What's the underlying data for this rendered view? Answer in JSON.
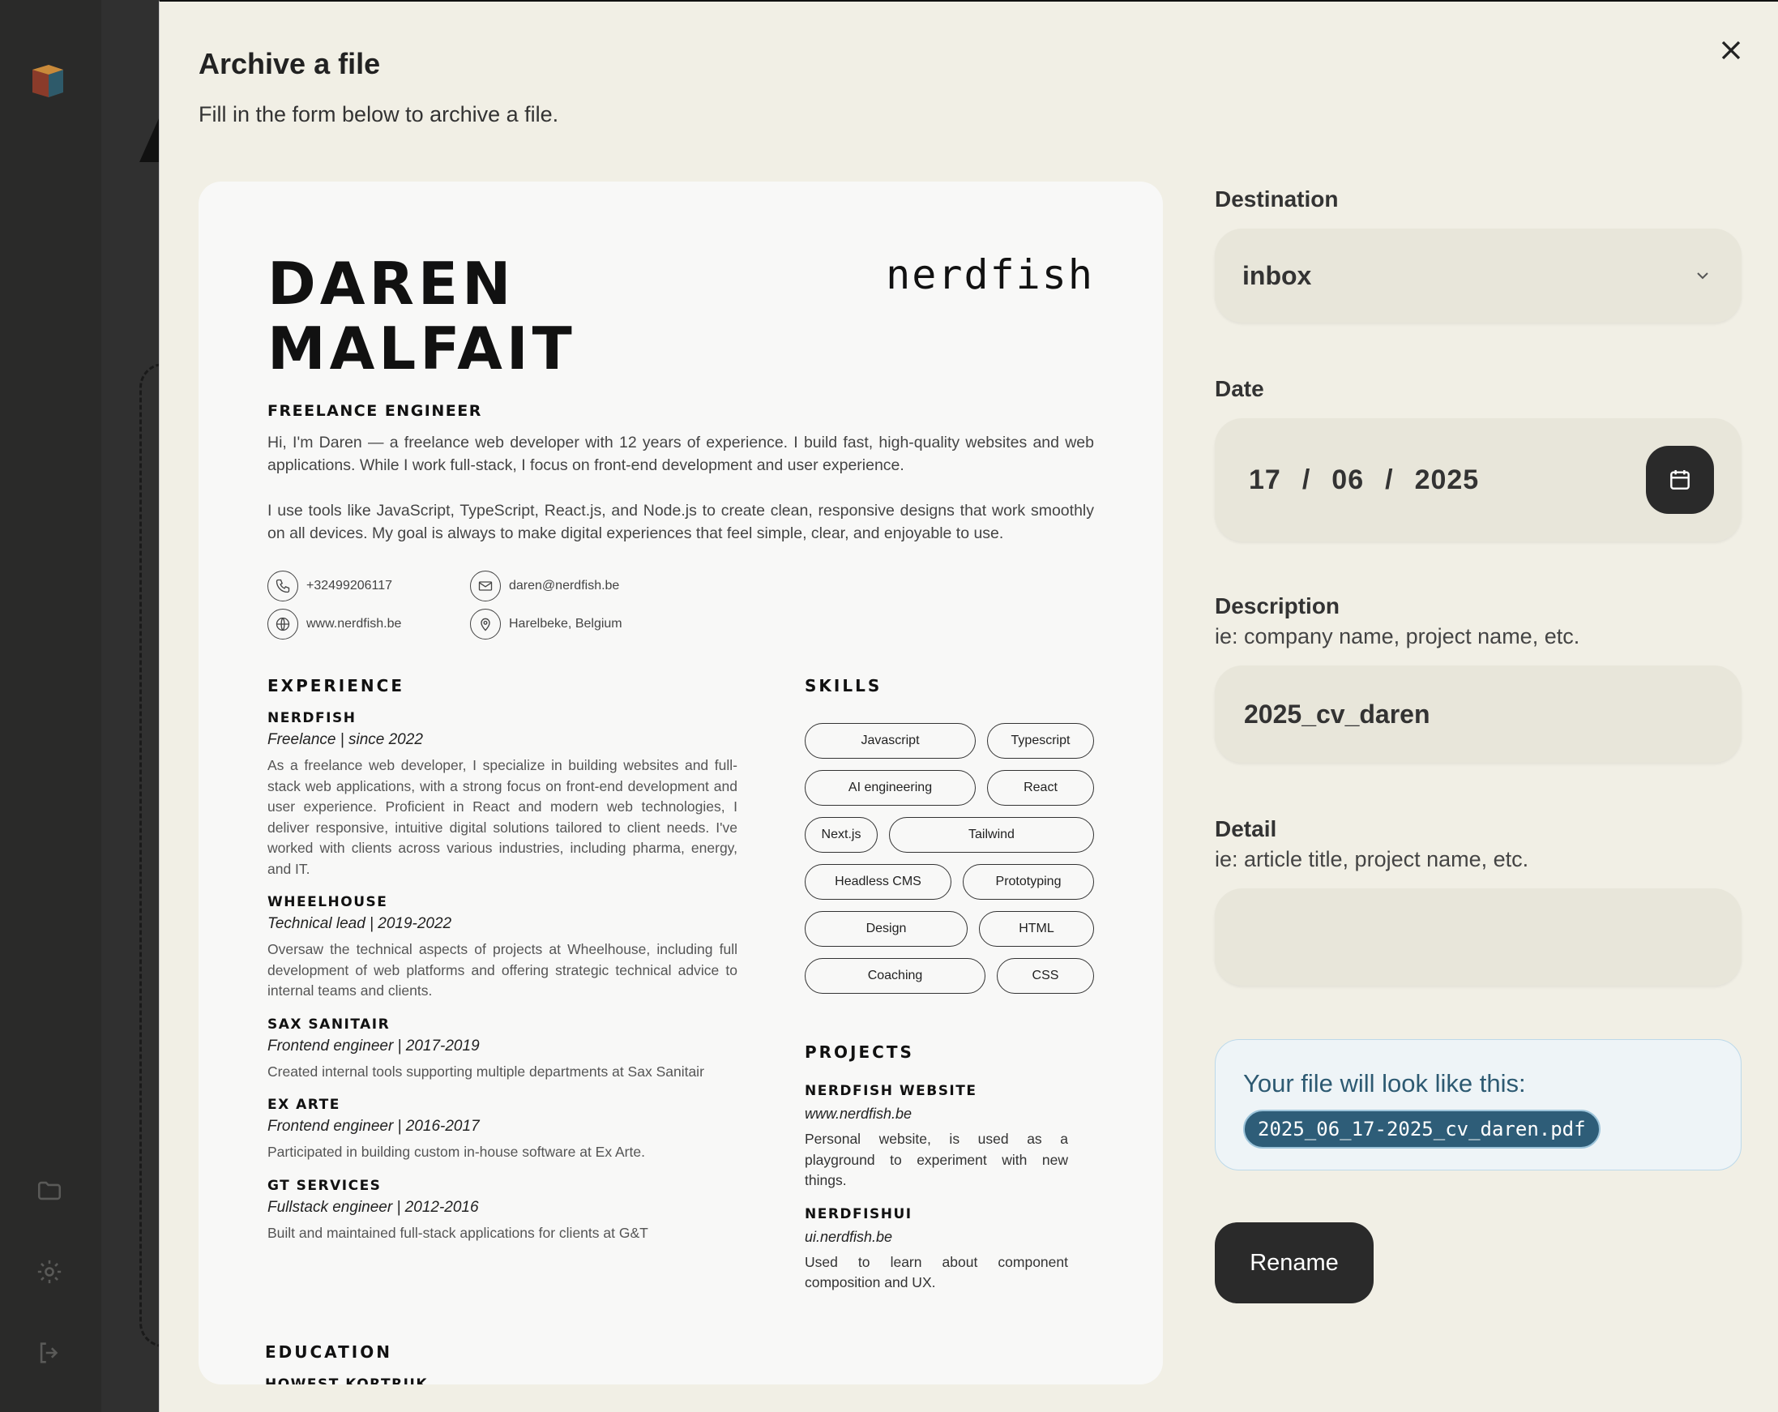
{
  "modal": {
    "title": "Archive a file",
    "subtitle": "Fill in the form below to archive a file."
  },
  "cv": {
    "name_line1": "DAREN",
    "name_line2": "MALFAIT",
    "brand": "nerdfish",
    "role": "FREELANCE ENGINEER",
    "intro1": "Hi, I'm Daren — a freelance web developer with 12 years of experience. I build fast, high-quality websites and web applications. While I work full-stack, I focus on front-end development and user experience.",
    "intro2": "I use tools like JavaScript, TypeScript, React.js, and Node.js to create clean, responsive designs that work smoothly on all devices. My goal is always to make digital experiences that feel simple, clear, and enjoyable to use.",
    "contacts": {
      "phone": "+32499206117",
      "email": "daren@nerdfish.be",
      "website": "www.nerdfish.be",
      "location": "Harelbeke, Belgium"
    },
    "experience_title": "EXPERIENCE",
    "jobs": [
      {
        "company": "NERDFISH",
        "role": "Freelance | since 2022",
        "desc": "As a freelance web developer, I specialize in building websites and full-stack web applications, with a strong focus on front-end development and user experience. Proficient in React and modern web technologies, I deliver responsive, intuitive digital solutions tailored to client needs. I've worked with clients across various industries, including pharma, energy, and IT."
      },
      {
        "company": "WHEELHOUSE",
        "role": "Technical lead | 2019-2022",
        "desc": "Oversaw the technical aspects of projects at Wheelhouse, including full development of web platforms and offering strategic technical advice to internal teams and clients."
      },
      {
        "company": "SAX SANITAIR",
        "role": "Frontend engineer | 2017-2019",
        "desc": "Created internal tools supporting multiple departments at Sax Sanitair"
      },
      {
        "company": "EX ARTE",
        "role": "Frontend engineer | 2016-2017",
        "desc": "Participated in building custom in-house software at Ex Arte."
      },
      {
        "company": "GT SERVICES",
        "role": "Fullstack engineer | 2012-2016",
        "desc": "Built and maintained full-stack applications for clients at G&T"
      }
    ],
    "skills_title": "SKILLS",
    "skills": [
      "Javascript",
      "Typescript",
      "AI engineering",
      "React",
      "Next.js",
      "Tailwind",
      "Headless CMS",
      "Prototyping",
      "Design",
      "HTML",
      "Coaching",
      "CSS"
    ],
    "projects_title": "PROJECTS",
    "projects": [
      {
        "name": "NERDFISH WEBSITE",
        "url": "www.nerdfish.be",
        "desc": "Personal website, is used as a playground to experiment with new things."
      },
      {
        "name": "NERDFISHUI",
        "url": "ui.nerdfish.be",
        "desc": "Used to learn about component composition and UX."
      }
    ],
    "education_title": "EDUCATION",
    "education_next": "HOWEST KORTRIJK"
  },
  "form": {
    "destination": {
      "label": "Destination",
      "value": "inbox"
    },
    "date": {
      "label": "Date",
      "day": "17",
      "month": "06",
      "year": "2025",
      "separator": "/"
    },
    "description": {
      "label": "Description",
      "hint": "ie: company name, project name, etc.",
      "value": "2025_cv_daren"
    },
    "detail": {
      "label": "Detail",
      "hint": "ie: article title, project name, etc.",
      "value": ""
    },
    "preview_label": "Your file will look like this:",
    "filename": "2025_06_17-2025_cv_daren.pdf",
    "submit_label": "Rename"
  },
  "icons": {
    "close": "close-icon",
    "chevron": "chevron-down-icon",
    "calendar": "calendar-icon",
    "folder": "folder-icon",
    "settings": "gear-icon",
    "logout": "logout-icon"
  },
  "colors": {
    "modal_bg": "#f1efe5",
    "field_bg": "#e8e6da",
    "primary_button": "#2a2a2a",
    "preview_box_bg": "#eef4f7",
    "filename_pill": "#2e5d78"
  }
}
